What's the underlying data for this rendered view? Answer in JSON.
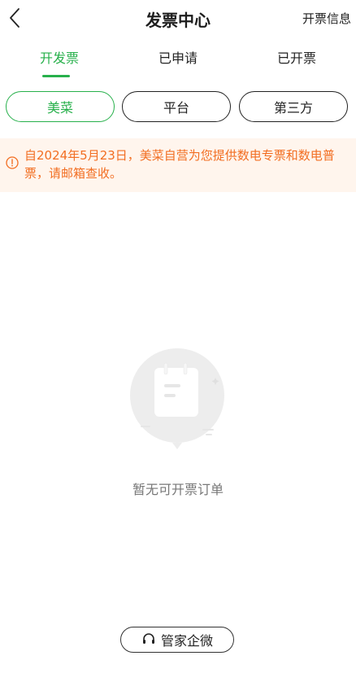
{
  "header": {
    "title": "发票中心",
    "info_link": "开票信息",
    "back_icon": "chevron-left-icon"
  },
  "tabs": [
    {
      "label": "开发票",
      "active": true
    },
    {
      "label": "已申请",
      "active": false
    },
    {
      "label": "已开票",
      "active": false
    }
  ],
  "filters": [
    {
      "label": "美菜",
      "selected": true
    },
    {
      "label": "平台",
      "selected": false
    },
    {
      "label": "第三方",
      "selected": false
    }
  ],
  "notice": {
    "icon": "alert-circle-icon",
    "text": "自2024年5月23日，美菜自营为您提供数电专票和数电普票，请邮箱查收。"
  },
  "empty_state": {
    "illustration": "empty-notepad-icon",
    "text": "暂无可开票订单"
  },
  "bottom_button": {
    "icon": "headset-icon",
    "label": "管家企微"
  },
  "colors": {
    "accent": "#27b04b",
    "notice_text": "#f26e22",
    "notice_bg": "#fff5ed"
  }
}
